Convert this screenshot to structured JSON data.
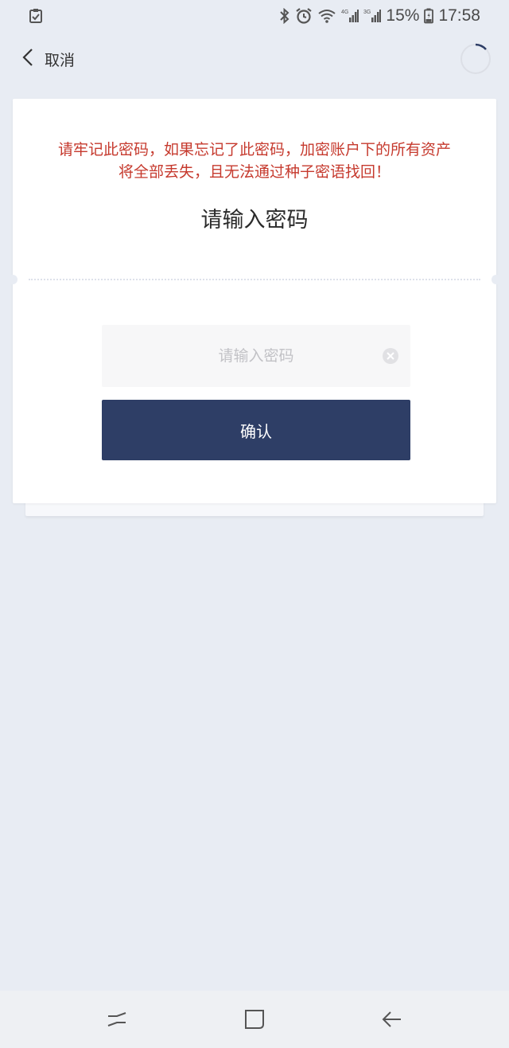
{
  "status_bar": {
    "battery": "15%",
    "time": "17:58",
    "icons": [
      "task-check-icon",
      "bluetooth-icon",
      "alarm-icon",
      "wifi-icon",
      "signal-4g-icon",
      "signal-3g-icon",
      "battery-icon"
    ]
  },
  "nav": {
    "back_label": "取消",
    "icons": [
      "chevron-left-icon",
      "loading-spinner-icon"
    ]
  },
  "card": {
    "warning_line1": "请牢记此密码，如果忘记了此密码，加密账户下的所有资产",
    "warning_line2": "将全部丢失，且无法通过种子密语找回！",
    "title": "请输入密码",
    "password_placeholder": "请输入密码",
    "password_value": "",
    "confirm_label": "确认"
  },
  "colors": {
    "background": "#e8ecf3",
    "warning": "#c63a2e",
    "button": "#2e3e66"
  },
  "system_nav": [
    "recents-icon",
    "home-icon",
    "back-arrow-icon"
  ]
}
